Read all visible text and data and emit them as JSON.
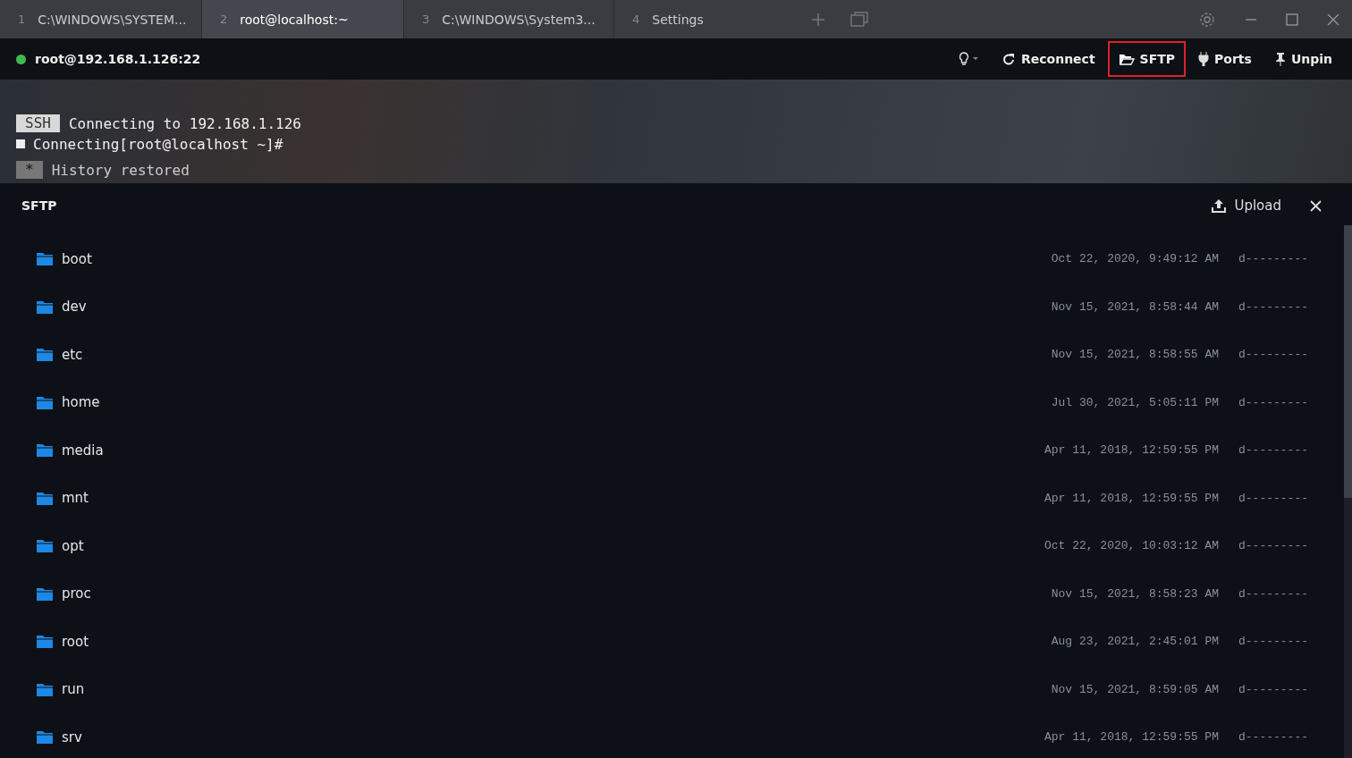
{
  "tabs": [
    {
      "number": "1",
      "label": "C:\\WINDOWS\\SYSTEM...",
      "selected": false
    },
    {
      "number": "2",
      "label": "root@localhost:~",
      "selected": true
    },
    {
      "number": "3",
      "label": "C:\\WINDOWS\\System3...",
      "selected": false
    },
    {
      "number": "4",
      "label": "Settings",
      "selected": false
    }
  ],
  "connection": {
    "host": "root@192.168.1.126:22",
    "connected": true
  },
  "toolbar": [
    {
      "kind": "bulb"
    },
    {
      "kind": "reconnect",
      "label": "Reconnect",
      "highlighted": false
    },
    {
      "kind": "sftp",
      "label": "SFTP",
      "highlighted": true
    },
    {
      "kind": "ports",
      "label": "Ports",
      "highlighted": false
    },
    {
      "kind": "unpin",
      "label": "Unpin",
      "highlighted": false
    }
  ],
  "terminal": {
    "lines": [
      {
        "badge": "SSH",
        "text": "Connecting to 192.168.1.126",
        "cursor": false
      },
      {
        "text": "Connecting[root@localhost ~]#",
        "cursor": true
      },
      {
        "badge": "*",
        "text": "History restored",
        "cursor": false
      }
    ]
  },
  "sftp": {
    "title": "SFTP",
    "upload": "Upload",
    "entries": [
      {
        "name": "boot",
        "modified": "Oct 22, 2020, 9:49:12 AM",
        "mode": "d---------"
      },
      {
        "name": "dev",
        "modified": "Nov 15, 2021, 8:58:44 AM",
        "mode": "d---------"
      },
      {
        "name": "etc",
        "modified": "Nov 15, 2021, 8:58:55 AM",
        "mode": "d---------"
      },
      {
        "name": "home",
        "modified": "Jul 30, 2021, 5:05:11 PM",
        "mode": "d---------"
      },
      {
        "name": "media",
        "modified": "Apr 11, 2018, 12:59:55 PM",
        "mode": "d---------"
      },
      {
        "name": "mnt",
        "modified": "Apr 11, 2018, 12:59:55 PM",
        "mode": "d---------"
      },
      {
        "name": "opt",
        "modified": "Oct 22, 2020, 10:03:12 AM",
        "mode": "d---------"
      },
      {
        "name": "proc",
        "modified": "Nov 15, 2021, 8:58:23 AM",
        "mode": "d---------"
      },
      {
        "name": "root",
        "modified": "Aug 23, 2021, 2:45:01 PM",
        "mode": "d---------"
      },
      {
        "name": "run",
        "modified": "Nov 15, 2021, 8:59:05 AM",
        "mode": "d---------"
      },
      {
        "name": "srv",
        "modified": "Apr 11, 2018, 12:59:55 PM",
        "mode": "d---------"
      }
    ]
  }
}
